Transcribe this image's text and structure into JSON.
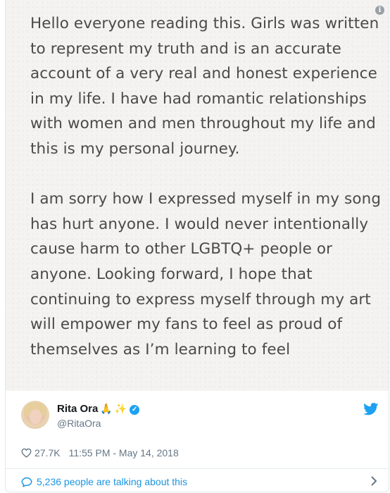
{
  "statement": {
    "paragraphs": [
      "Hello everyone reading this. Girls was written to represent my truth and is an accurate account of a very real and honest experience in my life. I have had romantic relationships with women and men throughout my life and this is my personal journey.",
      "I am sorry how I expressed myself in my song has hurt anyone. I would never intentionally cause harm to other LGBTQ+ people or anyone. Looking forward, I hope that continuing to express myself through my art will empower my fans to feel as proud of themselves as I’m learning to feel"
    ],
    "info_glyph": "i"
  },
  "author": {
    "name": "Rita Ora",
    "emoji_pray": "🙏",
    "emoji_sparkles": "✨",
    "verified_glyph": "✓",
    "handle": "@RitaOra"
  },
  "meta": {
    "likes": "27.7K",
    "timestamp": "11:55 PM - May 14, 2018"
  },
  "footer": {
    "talking": "5,236 people are talking about this"
  },
  "colors": {
    "twitter_blue": "#1da1f2",
    "link_blue": "#1b95e0",
    "muted": "#657786"
  }
}
